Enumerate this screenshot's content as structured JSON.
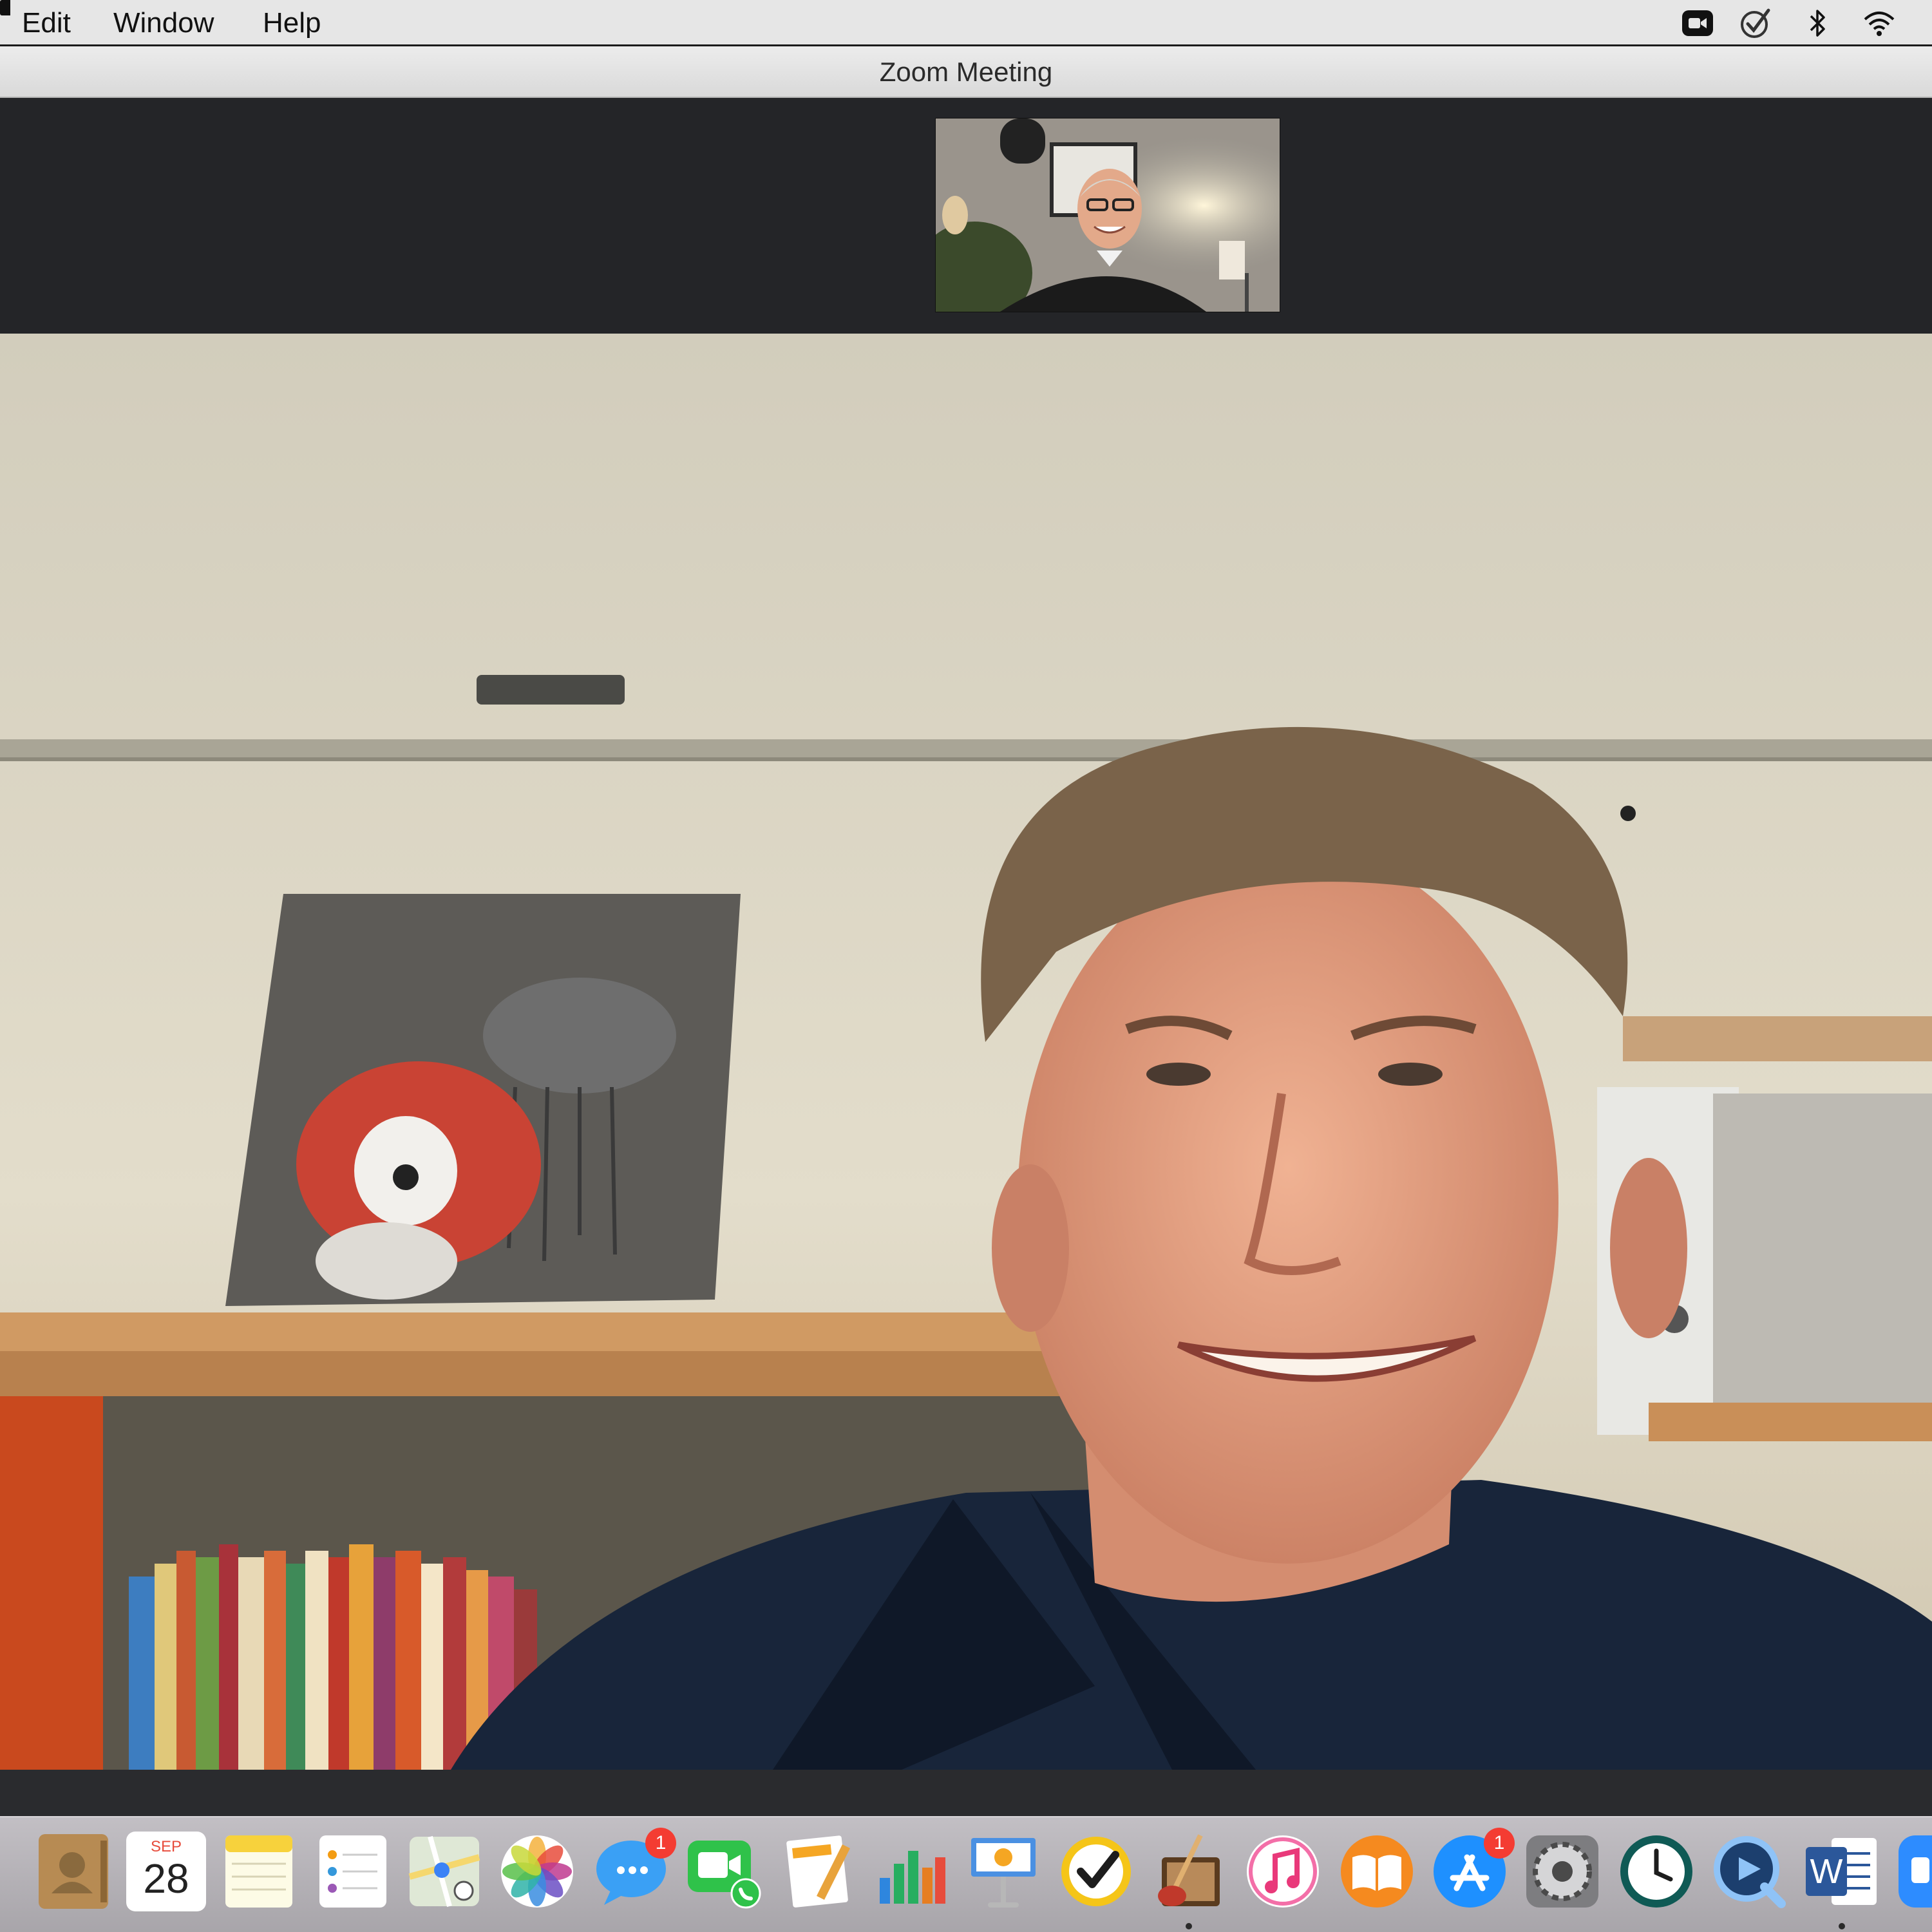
{
  "menubar": {
    "items": [
      {
        "label": "Edit"
      },
      {
        "label": "Window"
      },
      {
        "label": "Help"
      }
    ],
    "status_icons": [
      "zoom-status-icon",
      "check-status-icon",
      "bluetooth-icon",
      "wifi-icon",
      "battery-icon"
    ]
  },
  "window": {
    "title": "Zoom Meeting"
  },
  "dock": {
    "calendar_month": "SEP",
    "calendar_day": "28",
    "messages_badge": "1",
    "appstore_badge": "1",
    "word_letter": "W",
    "apps": [
      "contacts-icon",
      "calendar-icon",
      "notes-icon",
      "reminders-icon",
      "maps-icon",
      "photos-icon",
      "messages-icon",
      "facetime-icon",
      "pages-icon",
      "numbers-icon",
      "keynote-icon",
      "tasks-icon",
      "garageband-icon",
      "music-icon",
      "books-icon",
      "app-store-icon",
      "system-preferences-icon",
      "time-machine-icon",
      "quicktime-icon",
      "word-icon",
      "zoom-icon"
    ]
  }
}
